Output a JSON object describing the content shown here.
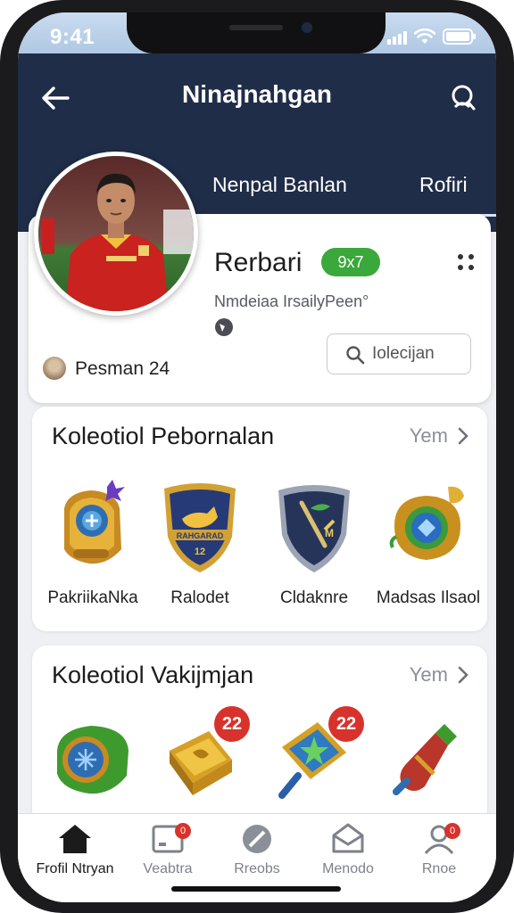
{
  "status_bar": {
    "time": "9:41"
  },
  "header": {
    "title": "Ninajnahgan"
  },
  "tabs": [
    {
      "label": "Nenpal Banlan"
    },
    {
      "label": "Rofiri"
    }
  ],
  "profile": {
    "name": "Rerbari",
    "score": "9x7",
    "subtitle": "Nmdeiaa IrsailyPeen°",
    "owner_label": "Pesman 24",
    "search_placeholder": "Iolecijan"
  },
  "collections": [
    {
      "title": "Koleotiol Pebornalan",
      "more_label": "Yem",
      "items": [
        {
          "label": "PakriikaNka",
          "icon": "bracer-icon"
        },
        {
          "label": "Ralodet",
          "icon": "shield-badge-icon"
        },
        {
          "label": "Cldaknre",
          "icon": "shield-sword-icon"
        },
        {
          "label": "Madsas Ilsaol",
          "icon": "amulet-icon"
        }
      ]
    },
    {
      "title": "Koleotiol Vakijmjan",
      "more_label": "Yem",
      "items": [
        {
          "icon": "green-bracer-icon"
        },
        {
          "icon": "gold-artifact-icon",
          "badge": "22"
        },
        {
          "icon": "star-scroll-icon",
          "badge": "22"
        },
        {
          "icon": "potion-icon"
        }
      ]
    }
  ],
  "bottom_nav": [
    {
      "label": "Frofil Ntryan",
      "icon": "home-icon",
      "active": true
    },
    {
      "label": "Veabtra",
      "icon": "card-icon",
      "badge": "0"
    },
    {
      "label": "Rreobs",
      "icon": "compass-icon"
    },
    {
      "label": "Menodo",
      "icon": "mail-icon"
    },
    {
      "label": "Rnoe",
      "icon": "user-icon",
      "badge": "0"
    }
  ],
  "colors": {
    "header_bg": "#1f2d48",
    "score_badge": "#3aa83a",
    "alert_badge": "#d8322c"
  }
}
